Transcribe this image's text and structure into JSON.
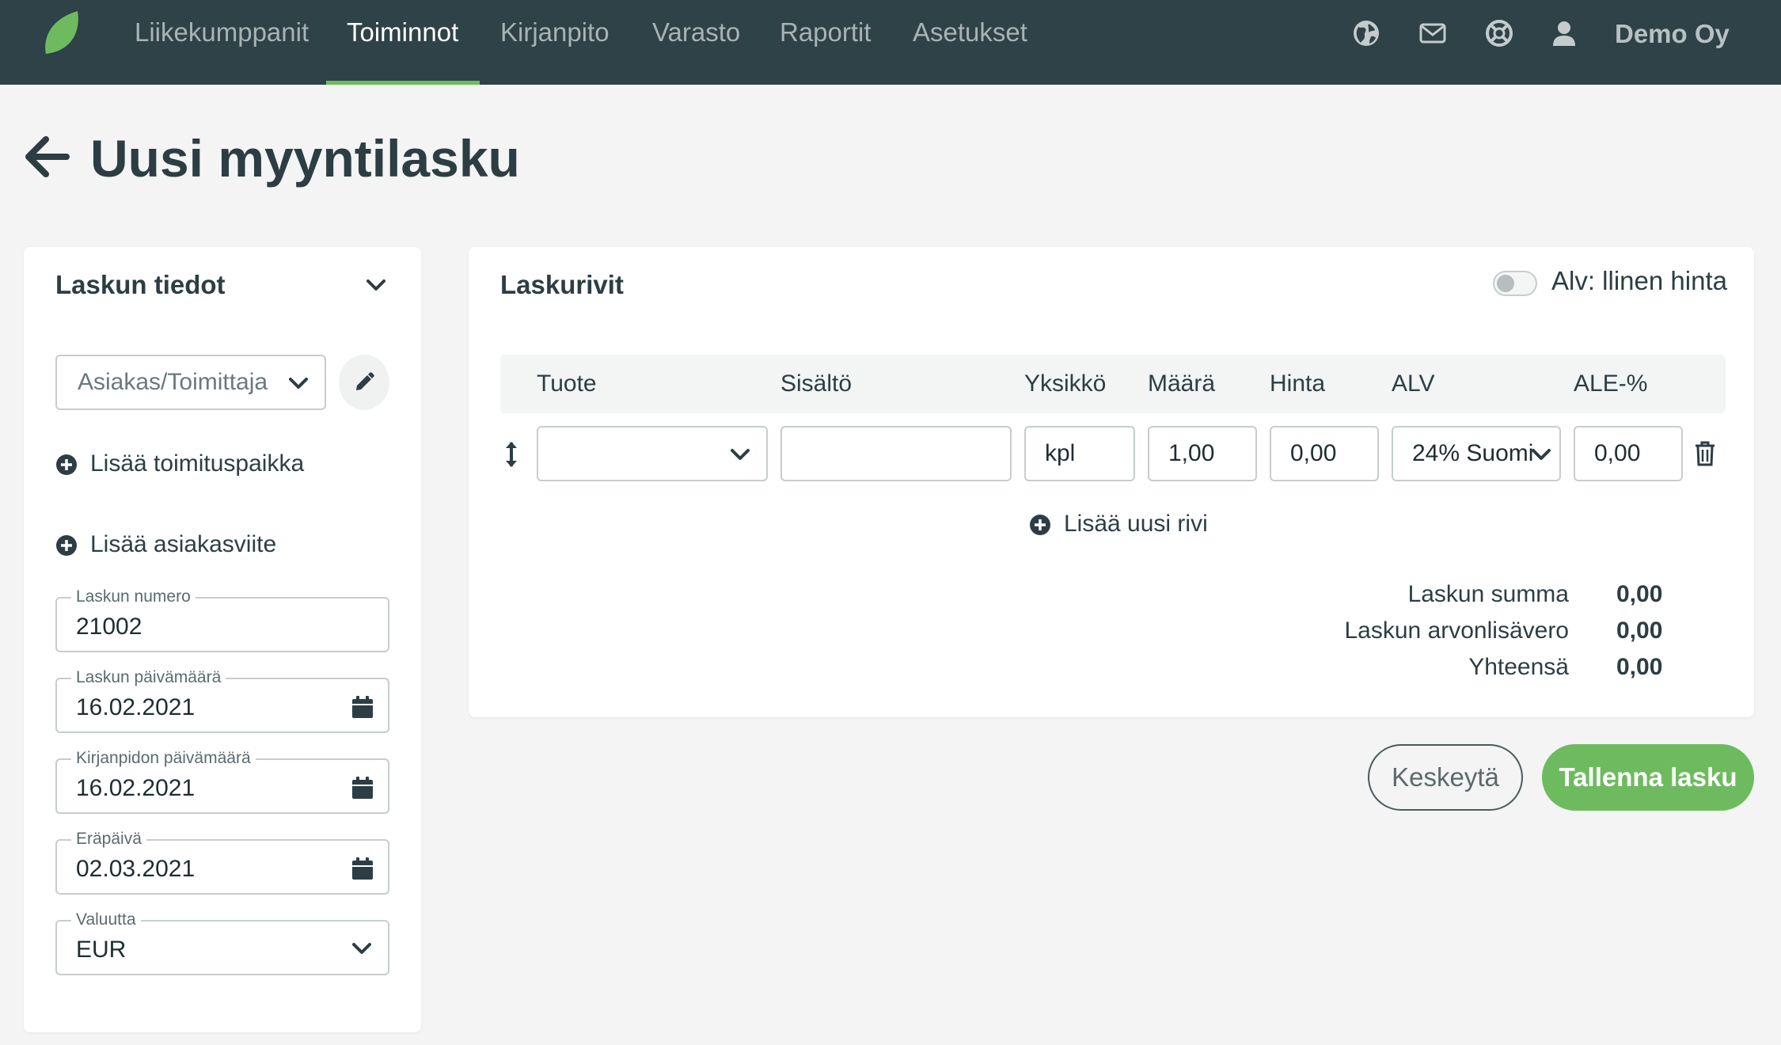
{
  "nav": {
    "items": [
      {
        "label": "Liikekumppanit",
        "active": false
      },
      {
        "label": "Toiminnot",
        "active": true
      },
      {
        "label": "Kirjanpito",
        "active": false
      },
      {
        "label": "Varasto",
        "active": false
      },
      {
        "label": "Raportit",
        "active": false
      },
      {
        "label": "Asetukset",
        "active": false
      }
    ],
    "icons": [
      "globe-icon",
      "mail-icon",
      "lifebuoy-icon",
      "user-icon"
    ],
    "company": "Demo Oy"
  },
  "page": {
    "title": "Uusi myyntilasku"
  },
  "invoice_info": {
    "title": "Laskun tiedot",
    "customer_placeholder": "Asiakas/Toimittaja",
    "add_delivery": "Lisää toimituspaikka",
    "add_reference": "Lisää asiakasviite",
    "fields": {
      "number": {
        "label": "Laskun numero",
        "value": "21002"
      },
      "date": {
        "label": "Laskun päivämäärä",
        "value": "16.02.2021"
      },
      "accounting_date": {
        "label": "Kirjanpidon päivämäärä",
        "value": "16.02.2021"
      },
      "due_date": {
        "label": "Eräpäivä",
        "value": "02.03.2021"
      },
      "currency": {
        "label": "Valuutta",
        "value": "EUR"
      }
    }
  },
  "invoice_rows": {
    "title": "Laskurivit",
    "vat_toggle_label": "Alv: llinen hinta",
    "vat_toggle_on": false,
    "columns": [
      "Tuote",
      "Sisältö",
      "Yksikkö",
      "Määrä",
      "Hinta",
      "ALV",
      "ALE-%"
    ],
    "row": {
      "product": "",
      "content": "",
      "unit": "kpl",
      "quantity": "1,00",
      "price": "0,00",
      "vat": "24% Suomi",
      "discount": "0,00"
    },
    "add_row": "Lisää uusi rivi",
    "totals": [
      {
        "label": "Laskun summa",
        "value": "0,00"
      },
      {
        "label": "Laskun arvonlisävero",
        "value": "0,00"
      },
      {
        "label": "Yhteensä",
        "value": "0,00"
      }
    ]
  },
  "actions": {
    "cancel": "Keskeytä",
    "save": "Tallenna lasku"
  },
  "colors": {
    "nav_bg": "#2e4247",
    "accent": "#6ebb5f",
    "text": "#2c3e44",
    "page_bg": "#f3f4f3"
  }
}
